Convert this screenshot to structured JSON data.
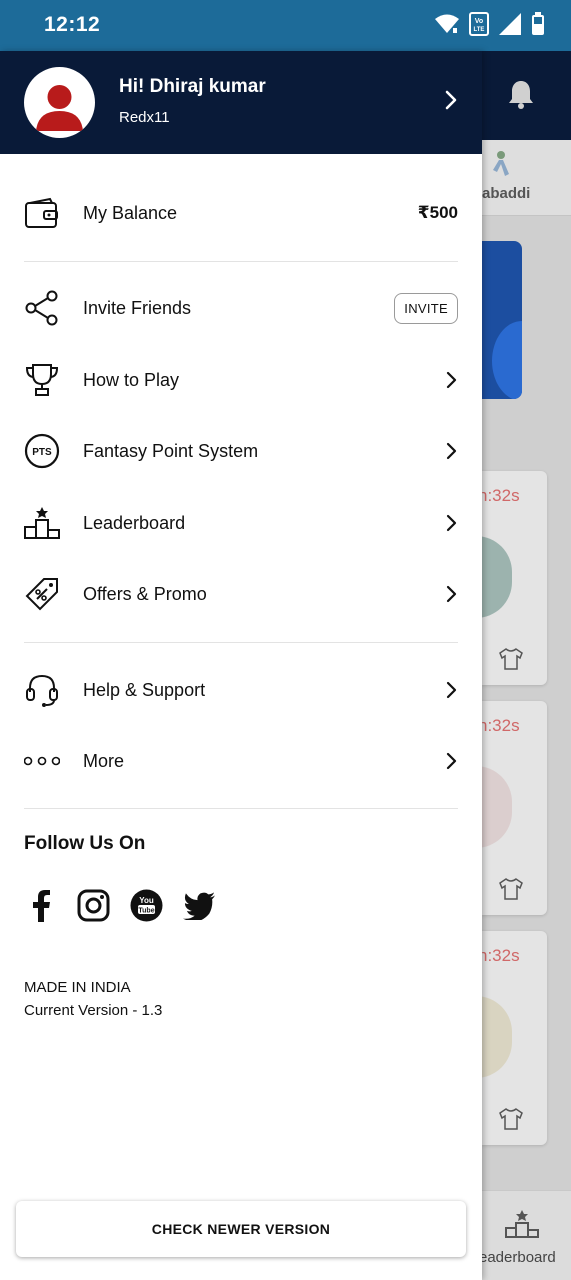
{
  "status_bar": {
    "time": "12:12",
    "icons": [
      "wifi-icon",
      "volte-icon",
      "signal-icon",
      "battery-icon"
    ]
  },
  "background_app": {
    "tab_label": "abaddi",
    "cards": [
      {
        "timer": "n:32s"
      },
      {
        "timer": "n:32s"
      },
      {
        "timer": "n:32s"
      }
    ],
    "bottom_nav_label": "eaderboard"
  },
  "drawer": {
    "header": {
      "greeting": "Hi! Dhiraj kumar",
      "username": "Redx11"
    },
    "balance": {
      "label": "My Balance",
      "value": "₹500"
    },
    "menu": [
      {
        "label": "Invite Friends",
        "action": "INVITE",
        "icon": "share-icon"
      },
      {
        "label": "How to Play",
        "icon": "trophy-icon"
      },
      {
        "label": "Fantasy Point System",
        "icon": "pts-icon"
      },
      {
        "label": "Leaderboard",
        "icon": "leaderboard-icon"
      },
      {
        "label": "Offers & Promo",
        "icon": "offer-tag-icon"
      },
      {
        "label": "Help & Support",
        "icon": "headset-icon"
      },
      {
        "label": "More",
        "icon": "more-dots-icon"
      }
    ],
    "follow": {
      "title": "Follow Us On",
      "networks": [
        "facebook-icon",
        "instagram-icon",
        "youtube-icon",
        "twitter-icon"
      ]
    },
    "footer": {
      "made_in": "MADE IN INDIA",
      "version": "Current Version - 1.3",
      "check_button": "CHECK NEWER VERSION"
    }
  },
  "colors": {
    "status_bar": "#1d6b99",
    "header_bg": "#091a38",
    "avatar_red": "#b81b1b",
    "timer_red": "#d06868"
  }
}
